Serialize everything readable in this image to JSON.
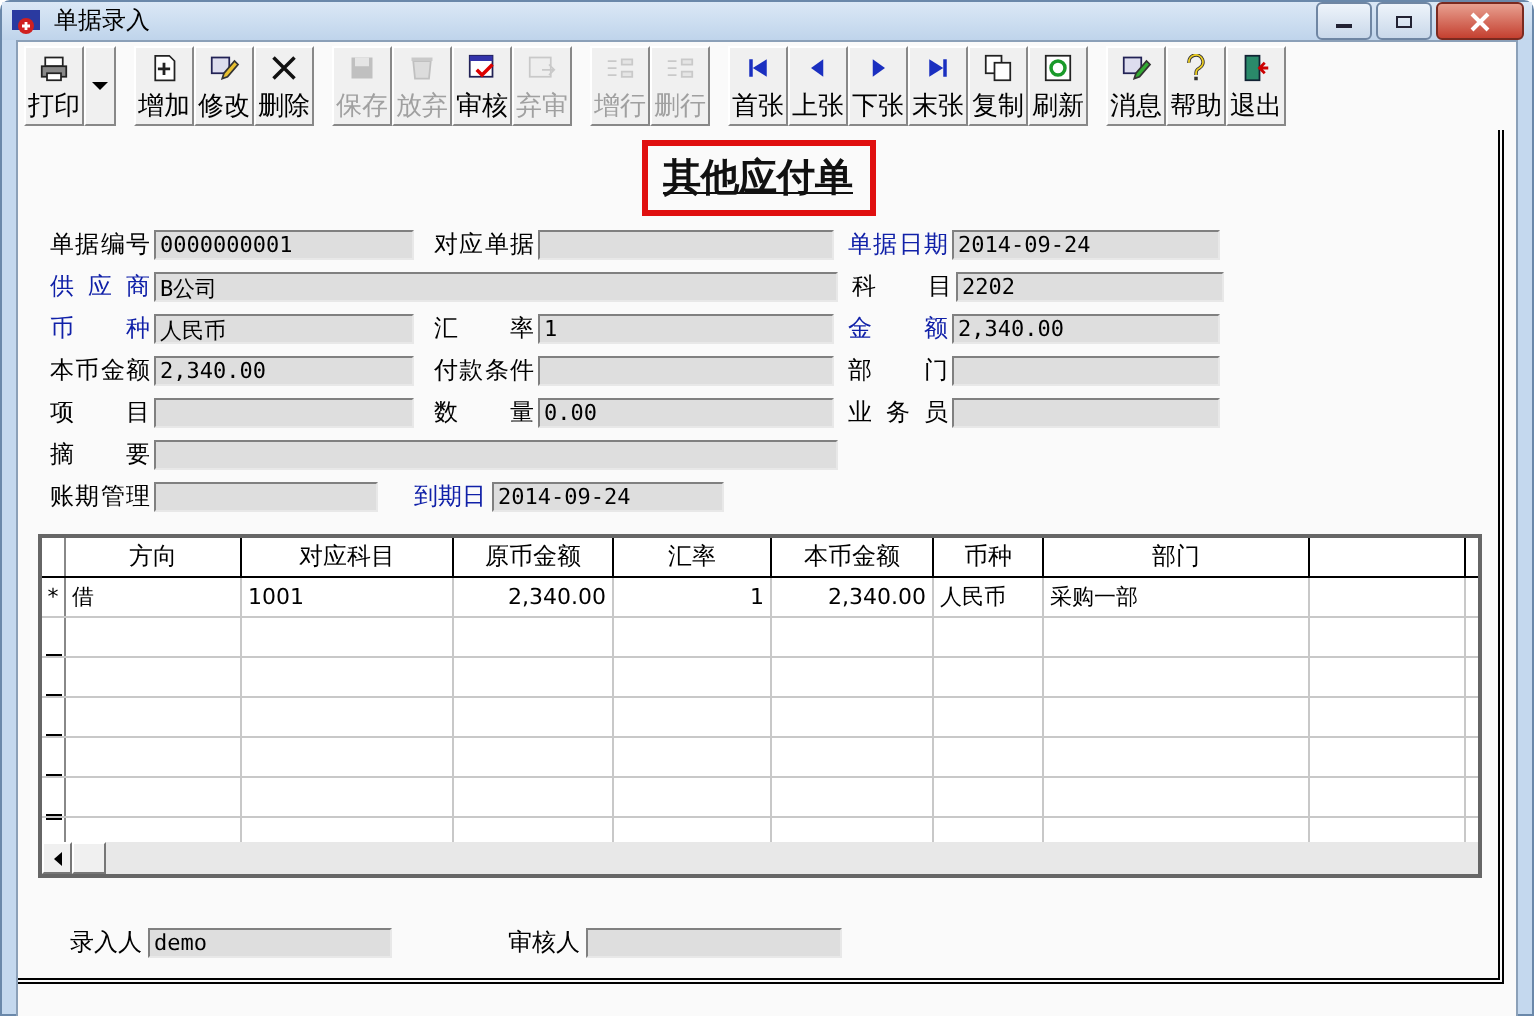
{
  "window": {
    "title": "单据录入"
  },
  "toolbar": [
    [
      {
        "label": "打印",
        "disabled": false,
        "menu": true
      }
    ],
    [
      {
        "label": "增加",
        "disabled": false,
        "menu": false
      },
      {
        "label": "修改",
        "disabled": false,
        "menu": false
      },
      {
        "label": "删除",
        "disabled": false,
        "menu": false
      }
    ],
    [
      {
        "label": "保存",
        "disabled": true,
        "menu": false
      },
      {
        "label": "放弃",
        "disabled": true,
        "menu": false
      },
      {
        "label": "审核",
        "disabled": false,
        "menu": false
      },
      {
        "label": "弃审",
        "disabled": true,
        "menu": false
      }
    ],
    [
      {
        "label": "增行",
        "disabled": true,
        "menu": false
      },
      {
        "label": "删行",
        "disabled": true,
        "menu": false
      }
    ],
    [
      {
        "label": "首张",
        "disabled": false,
        "menu": false
      },
      {
        "label": "上张",
        "disabled": false,
        "menu": false
      },
      {
        "label": "下张",
        "disabled": false,
        "menu": false
      },
      {
        "label": "末张",
        "disabled": false,
        "menu": false
      },
      {
        "label": "复制",
        "disabled": false,
        "menu": false
      },
      {
        "label": "刷新",
        "disabled": false,
        "menu": false
      }
    ],
    [
      {
        "label": "消息",
        "disabled": false,
        "menu": false
      },
      {
        "label": "帮助",
        "disabled": false,
        "menu": false
      },
      {
        "label": "退出",
        "disabled": false,
        "menu": false
      }
    ]
  ],
  "form": {
    "title": "其他应付单",
    "highlighted": true,
    "rows": [
      {
        "kind": "normal",
        "fields": [
          {
            "label": "单据编号",
            "value": "0000000001",
            "required": false
          },
          {
            "label": "对应单据",
            "required": false
          },
          {
            "label": "单据日期",
            "value": "2014-09-24",
            "required": true
          }
        ]
      },
      {
        "kind": "normal",
        "fields": [
          {
            "label": "供应商",
            "value": "B公司",
            "required": true
          },
          {
            "label": "科目",
            "value": "2202",
            "required": false
          }
        ]
      },
      {
        "kind": "normal",
        "fields": [
          {
            "label": "币种",
            "value": "人民币",
            "required": true
          },
          {
            "label": "汇率",
            "value": "1",
            "required": false
          },
          {
            "label": "金额",
            "value": "2,340.00",
            "required": true
          }
        ]
      },
      {
        "kind": "normal",
        "fields": [
          {
            "label": "本币金额",
            "value": "2,340.00",
            "required": false
          },
          {
            "label": "付款条件",
            "required": false
          },
          {
            "label": "部门",
            "required": false
          }
        ]
      },
      {
        "kind": "normal",
        "fields": [
          {
            "label": "项目",
            "required": false
          },
          {
            "label": "数量",
            "value": "0.00",
            "required": false
          },
          {
            "label": "业务员",
            "required": false
          }
        ]
      },
      {
        "kind": "normal",
        "fields": [
          {
            "label": "摘要",
            "required": false
          }
        ]
      },
      {
        "kind": "compact",
        "fields": [
          {
            "label": "账期管理",
            "required": false
          },
          {
            "label": "到期日",
            "value": "2014-09-24",
            "required": true
          }
        ]
      }
    ]
  },
  "grid": {
    "columns": [
      {
        "name": "方向",
        "numeric": false
      },
      {
        "name": "对应科目",
        "numeric": false
      },
      {
        "name": "原币金额",
        "numeric": true
      },
      {
        "name": "汇率",
        "numeric": true
      },
      {
        "name": "本币金额",
        "numeric": true
      },
      {
        "name": "币种",
        "numeric": false
      },
      {
        "name": "部门",
        "numeric": false
      }
    ],
    "rows": [
      {
        "marker": "*",
        "cells": [
          "借",
          "1001",
          "2,340.00",
          "1",
          "2,340.00",
          "人民币",
          "采购一部"
        ]
      }
    ]
  },
  "footer": [
    {
      "label": "录入人",
      "value": "demo"
    },
    {
      "label": "审核人"
    }
  ]
}
